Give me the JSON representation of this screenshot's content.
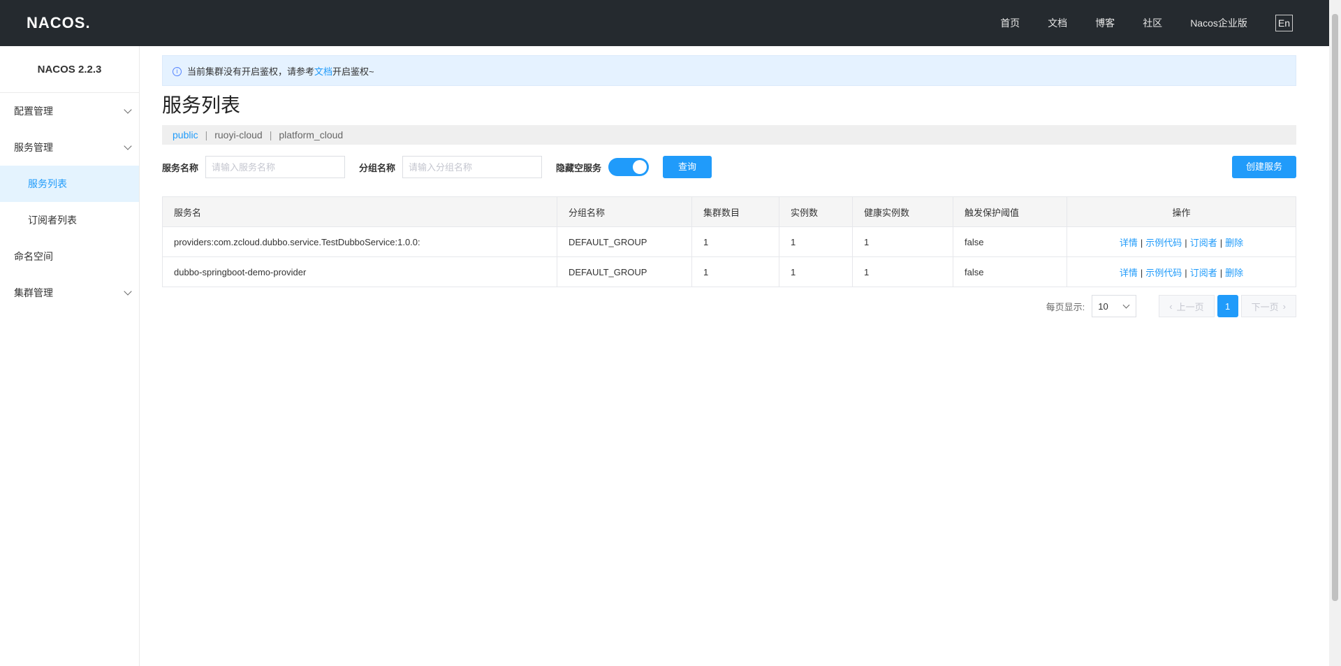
{
  "header": {
    "logo": "NACOS.",
    "nav": [
      "首页",
      "文档",
      "博客",
      "社区",
      "Nacos企业版"
    ],
    "lang": "En"
  },
  "sidebar": {
    "version": "NACOS 2.2.3",
    "items": [
      {
        "label": "配置管理",
        "expandable": true
      },
      {
        "label": "服务管理",
        "expandable": true
      },
      {
        "label": "服务列表",
        "sub": true,
        "active": true
      },
      {
        "label": "订阅者列表",
        "sub": true
      },
      {
        "label": "命名空间"
      },
      {
        "label": "集群管理",
        "expandable": true
      }
    ]
  },
  "notice": {
    "text_before": "当前集群没有开启鉴权，请参考",
    "link": "文档",
    "text_after": "开启鉴权~"
  },
  "title": "服务列表",
  "namespaces": [
    "public",
    "ruoyi-cloud",
    "platform_cloud"
  ],
  "filter": {
    "service_label": "服务名称",
    "service_placeholder": "请输入服务名称",
    "group_label": "分组名称",
    "group_placeholder": "请输入分组名称",
    "hide_empty_label": "隐藏空服务",
    "hide_empty_on": true,
    "query_btn": "查询",
    "create_btn": "创建服务"
  },
  "table": {
    "columns": [
      "服务名",
      "分组名称",
      "集群数目",
      "实例数",
      "健康实例数",
      "触发保护阈值",
      "操作"
    ],
    "rows": [
      [
        "providers:com.zcloud.dubbo.service.TestDubboService:1.0.0:",
        "DEFAULT_GROUP",
        "1",
        "1",
        "1",
        "false"
      ],
      [
        "dubbo-springboot-demo-provider",
        "DEFAULT_GROUP",
        "1",
        "1",
        "1",
        "false"
      ]
    ],
    "ops": [
      "详情",
      "示例代码",
      "订阅者",
      "删除"
    ]
  },
  "pager": {
    "size_label": "每页显示:",
    "size": "10",
    "prev": "上一页",
    "page": "1",
    "next": "下一页"
  },
  "colors": {
    "accent": "#209bfa",
    "header_bg": "#252a2f"
  }
}
